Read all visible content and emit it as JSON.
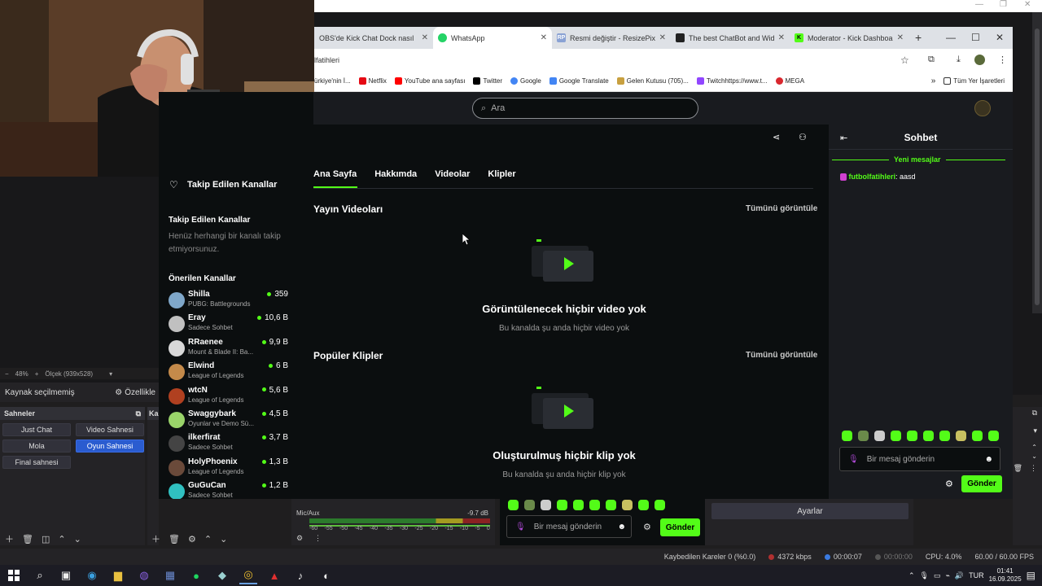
{
  "browser": {
    "tabs": [
      {
        "title": "OBS'de Kick Chat Dock nasıl",
        "color": "#e0e0e0"
      },
      {
        "title": "WhatsApp",
        "color": "#25d366"
      },
      {
        "title": "Resmi değiştir - ResizePixel",
        "color": "#8aa2d4"
      },
      {
        "title": "The best ChatBot and Widg",
        "color": "#222222"
      },
      {
        "title": "Moderator - Kick Dashboard",
        "color": "#53fc18"
      }
    ],
    "address": "lfatihleri",
    "bookmarks": [
      "ürkiye'nin İ...",
      "Netflix",
      "YouTube ana sayfası",
      "Twitter",
      "Google",
      "Google Translate",
      "Gelen Kutusu (705)...",
      "Twitchhttps://www.t...",
      "MEGA"
    ],
    "all_bookmarks": "Tüm Yer İşaretleri"
  },
  "kick": {
    "search_placeholder": "Ara",
    "followed_header": "Takip Edilen Kanallar",
    "followed_section": "Takip Edilen Kanallar",
    "followed_empty": "Henüz herhangi bir kanalı takip etmiyorsunuz.",
    "recommended": "Önerilen Kanallar",
    "channels": [
      {
        "name": "Shilla",
        "game": "PUBG: Battlegrounds",
        "viewers": "359",
        "color": "#7fa7c9"
      },
      {
        "name": "Eray",
        "game": "Sadece Sohbet",
        "viewers": "10,6 B",
        "color": "#c0c0c0"
      },
      {
        "name": "RRaenee",
        "game": "Mount & Blade II: Ba...",
        "viewers": "9,9 B",
        "color": "#d8d8d8"
      },
      {
        "name": "Elwind",
        "game": "League of Legends",
        "viewers": "6 B",
        "color": "#c48a4a"
      },
      {
        "name": "wtcN",
        "game": "League of Legends",
        "viewers": "5,6 B",
        "color": "#b04020"
      },
      {
        "name": "Swaggybark",
        "game": "Oyunlar ve Demo Sü...",
        "viewers": "4,5 B",
        "color": "#9ad46a"
      },
      {
        "name": "ilkerfirat",
        "game": "Sadece Sohbet",
        "viewers": "3,7 B",
        "color": "#444"
      },
      {
        "name": "HolyPhoenix",
        "game": "League of Legends",
        "viewers": "1,3 B",
        "color": "#6a4a3a"
      },
      {
        "name": "GuGuCan",
        "game": "Sadece Sohbet",
        "viewers": "1,2 B",
        "color": "#30c0c0"
      }
    ],
    "nav": [
      "Ana Sayfa",
      "Hakkımda",
      "Videolar",
      "Klipler"
    ],
    "videos_title": "Yayın Videoları",
    "view_all": "Tümünü görüntüle",
    "no_video_title": "Görüntülenecek hiçbir video yok",
    "no_video_sub": "Bu kanalda şu anda hiçbir video yok",
    "clips_title": "Popüler Klipler",
    "no_clip_title": "Oluşturulmuş hiçbir klip yok",
    "no_clip_sub": "Bu kanalda şu anda hiçbir klip yok",
    "chat_title": "Sohbet",
    "new_messages": "Yeni mesajlar",
    "message_user": "futbolfatihleri",
    "message_text": ": aasd",
    "msg_placeholder": "Bir mesaj gönderin",
    "send": "Gönder"
  },
  "obs": {
    "zoom": "48%",
    "scale": "Ölçek (939x528)",
    "no_source": "Kaynak seçilmemiş",
    "properties": "Özellikle",
    "scenes_title": "Sahneler",
    "scenes": [
      "Just Chat",
      "Video Sahnesi",
      "Mola",
      "Oyun Sahnesi",
      "Final sahnesi"
    ],
    "active_scene": "Oyun Sahnesi",
    "sources_title": "Ka",
    "mic": "Mic/Aux",
    "db": "-9.7 dB",
    "scale_ticks": [
      "-60",
      "-55",
      "-50",
      "-45",
      "-40",
      "-35",
      "-30",
      "-25",
      "-20",
      "-15",
      "-10",
      "-5",
      "0"
    ],
    "settings": "Ayarlar",
    "dropped": "Kaybedilen Kareler 0 (%0.0)",
    "bitrate": "4372 kbps",
    "time1": "00:00:07",
    "time2": "00:00:00",
    "cpu": "CPU: 4.0%",
    "fps": "60.00 / 60.00 FPS"
  },
  "taskbar": {
    "lang": "TUR",
    "time": "01:41",
    "date": "16.09.2025"
  }
}
